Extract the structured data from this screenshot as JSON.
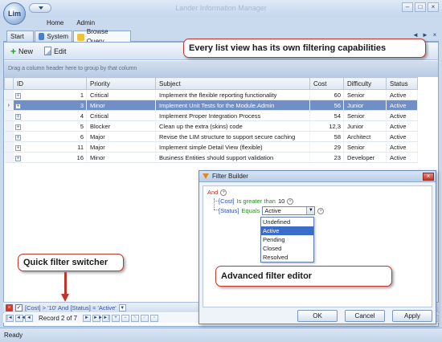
{
  "app": {
    "title": "Lander Information Manager",
    "orb_label": "Lim"
  },
  "window_buttons": {
    "minimize": "–",
    "maximize": "□",
    "close": "×"
  },
  "menu": {
    "items": [
      {
        "label": "Home"
      },
      {
        "label": "Admin"
      }
    ]
  },
  "tabs": [
    {
      "label": "Start",
      "active": false
    },
    {
      "label": "System",
      "active": false
    },
    {
      "label": "Browse Query",
      "active": true
    }
  ],
  "tab_nav": {
    "left": "◄",
    "right": "►",
    "close": "×"
  },
  "toolbar": {
    "new_label": "New",
    "edit_label": "Edit"
  },
  "grid": {
    "group_hint": "Drag a column header here to group by that column",
    "columns": [
      "ID",
      "Priority",
      "Subject",
      "Cost",
      "Difficulty",
      "Status"
    ],
    "rows": [
      {
        "id": "1",
        "priority": "Critical",
        "subject": "Implement the flexible reporting functionality",
        "cost": "60",
        "difficulty": "Senior",
        "status": "Active",
        "selected": false
      },
      {
        "id": "3",
        "priority": "Minor",
        "subject": "Implement Unit Tests for the Module.Admin",
        "cost": "56",
        "difficulty": "Junior",
        "status": "Active",
        "selected": true
      },
      {
        "id": "4",
        "priority": "Critical",
        "subject": "Implement Proper Integration Process",
        "cost": "54",
        "difficulty": "Senior",
        "status": "Active",
        "selected": false
      },
      {
        "id": "5",
        "priority": "Blocker",
        "subject": "Clean up the extra (skins) code",
        "cost": "12,3",
        "difficulty": "Junior",
        "status": "Active",
        "selected": false
      },
      {
        "id": "6",
        "priority": "Major",
        "subject": "Revise the LIM structure to support secure caching",
        "cost": "58",
        "difficulty": "Architect",
        "status": "Active",
        "selected": false
      },
      {
        "id": "11",
        "priority": "Major",
        "subject": "Implement simple Detail View (flexible)",
        "cost": "29",
        "difficulty": "Senior",
        "status": "Active",
        "selected": false
      },
      {
        "id": "16",
        "priority": "Minor",
        "subject": "Business Entities should support validation",
        "cost": "23",
        "difficulty": "Developer",
        "status": "Active",
        "selected": false
      }
    ]
  },
  "callouts": {
    "top": "Every list view has its own filtering capabilities",
    "quick": "Quick filter switcher",
    "advanced": "Advanced filter editor"
  },
  "filter_bar": {
    "text": "[Cost] > '10' And [Status] = 'Active'"
  },
  "navigator": {
    "record_text": "Record 2 of 7"
  },
  "status_bar": {
    "text": "Ready"
  },
  "filter_builder": {
    "title": "Filter Builder",
    "group_op": "And",
    "conditions": [
      {
        "field": "[Cost]",
        "operator": "Is greater than",
        "value": "10"
      },
      {
        "field": "[Status]",
        "operator": "Equals",
        "value": "Active"
      }
    ],
    "dropdown_options": [
      "Undefined",
      "Active",
      "Pending",
      "Closed",
      "Resolved"
    ],
    "highlighted_option": "Active",
    "ok_label": "OK",
    "cancel_label": "Cancel",
    "apply_label": "Apply"
  }
}
